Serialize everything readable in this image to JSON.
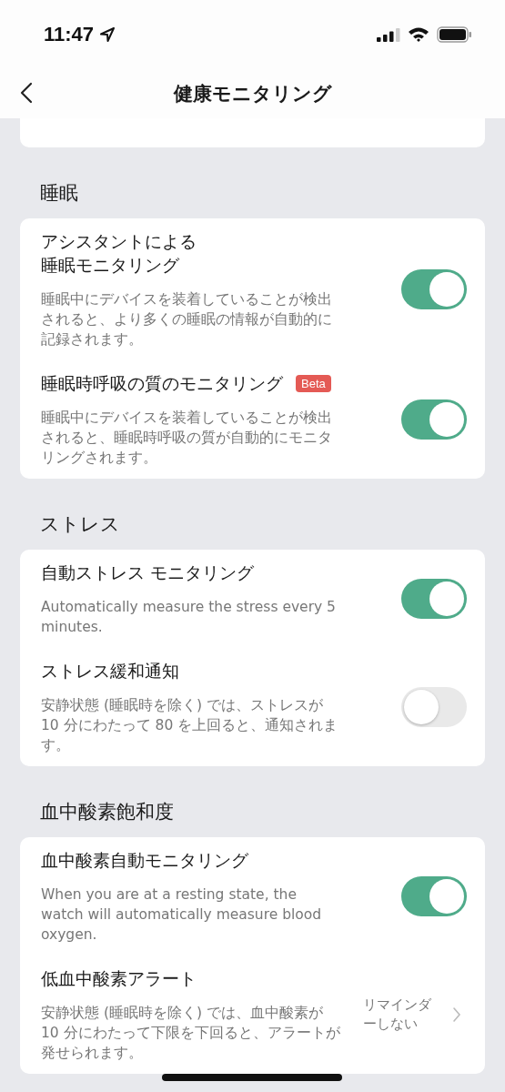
{
  "status_bar": {
    "time": "11:47"
  },
  "nav": {
    "title": "健康モニタリング"
  },
  "sections": [
    {
      "title": "睡眠",
      "rows": [
        {
          "kind": "toggle",
          "title": "アシスタントによる睡眠モニタリング",
          "description": "睡眠中にデバイスを装着していることが検出されると、より多くの睡眠の情報が自動的に記録されます。",
          "on": true
        },
        {
          "kind": "toggle",
          "title": "睡眠時呼吸の質のモニタリング",
          "badge": "Beta",
          "description": "睡眠中にデバイスを装着していることが検出されると、睡眠時呼吸の質が自動的にモニタリングされます。",
          "on": true
        }
      ]
    },
    {
      "title": "ストレス",
      "rows": [
        {
          "kind": "toggle",
          "title": "自動ストレス モニタリング",
          "description": "Automatically measure the stress every 5 minutes.",
          "on": true
        },
        {
          "kind": "toggle",
          "title": "ストレス緩和通知",
          "description": "安静状態 (睡眠時を除く) では、ストレスが 10 分にわたって 80 を上回ると、通知されます。",
          "on": false
        }
      ]
    },
    {
      "title": "血中酸素飽和度",
      "rows": [
        {
          "kind": "toggle",
          "title": "血中酸素自動モニタリング",
          "description": "When you are at a resting state, the watch will automatically measure blood oxygen.",
          "on": true
        },
        {
          "kind": "link",
          "title": "低血中酸素アラート",
          "description": "安静状態 (睡眠時を除く) では、血中酸素が 10 分にわたって下限を下回ると、アラートが発せられます。",
          "value": "リマインダーしない"
        }
      ]
    }
  ]
}
